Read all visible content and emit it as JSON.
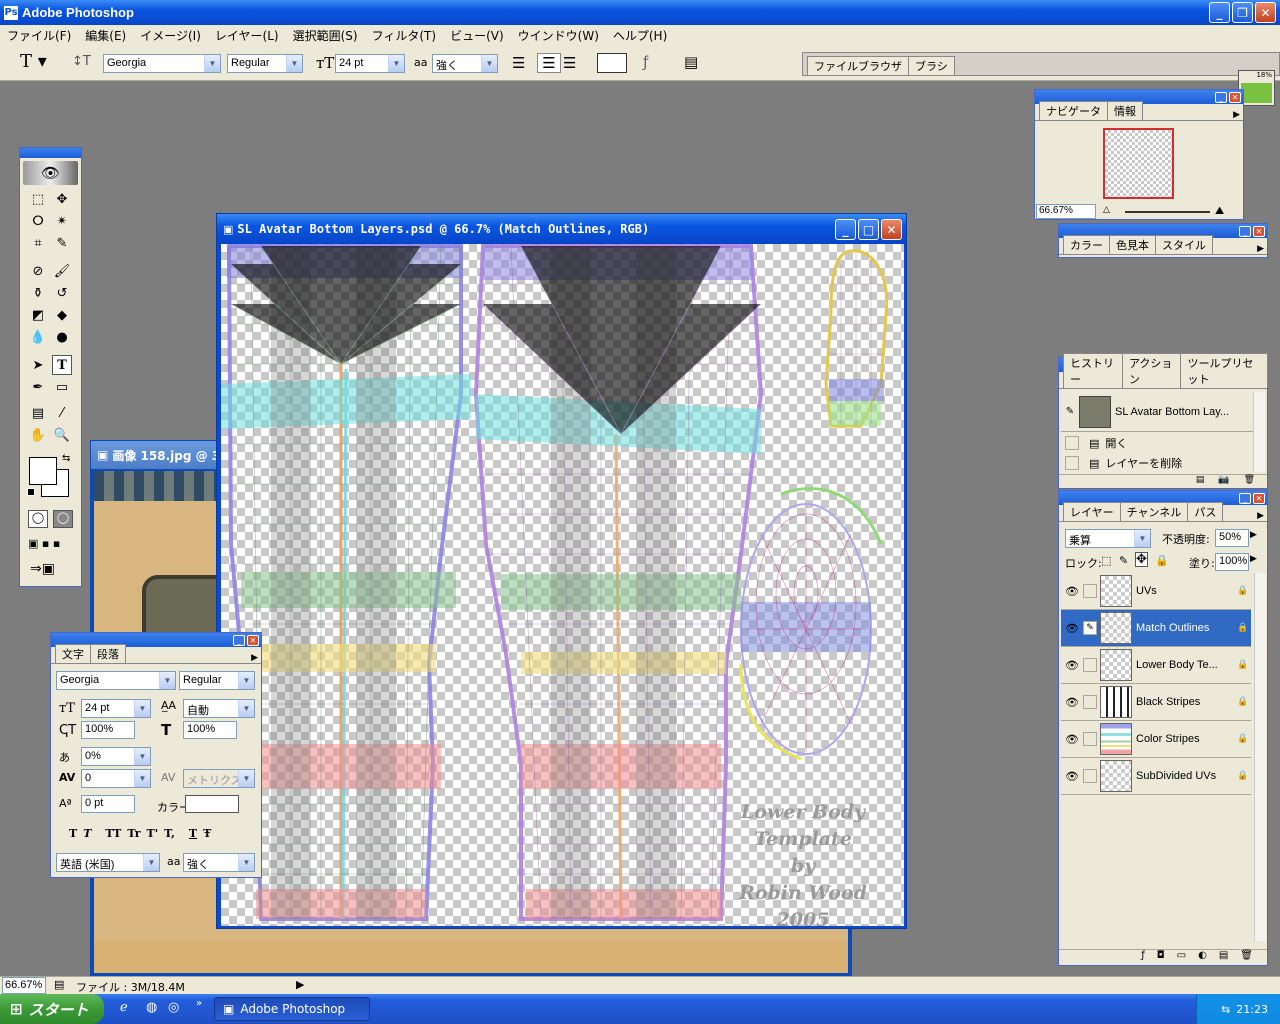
{
  "app": {
    "title": "Adobe Photoshop"
  },
  "menu": [
    "ファイル(F)",
    "編集(E)",
    "イメージ(I)",
    "レイヤー(L)",
    "選択範囲(S)",
    "フィルタ(T)",
    "ビュー(V)",
    "ウインドウ(W)",
    "ヘルプ(H)"
  ],
  "options": {
    "tool_glyph": "T",
    "font_family": "Georgia",
    "font_style": "Regular",
    "font_size": "24 pt",
    "aa_label": "aa",
    "antialias": "強く",
    "palette_well_tabs": [
      "ファイルブラウザ",
      "ブラシ"
    ]
  },
  "document": {
    "title": "SL Avatar Bottom Layers.psd @ 66.7% (Match Outlines, RGB)",
    "watermark": [
      "Lower Body",
      "Template",
      "by",
      "Robin Wood",
      "2005"
    ]
  },
  "bg_document": {
    "title": "画像 158.jpg @ 3"
  },
  "navigator": {
    "tabs": [
      "ナビゲータ",
      "情報"
    ],
    "zoom": "66.67%"
  },
  "color_palette": {
    "tabs": [
      "カラー",
      "色見本",
      "スタイル"
    ]
  },
  "history": {
    "tabs": [
      "ヒストリー",
      "アクション",
      "ツールプリセット"
    ],
    "snapshot": "SL Avatar Bottom Lay...",
    "items": [
      "開く",
      "レイヤーを削除"
    ]
  },
  "layers": {
    "tabs": [
      "レイヤー",
      "チャンネル",
      "パス"
    ],
    "blend_mode": "乗算",
    "opacity_label": "不透明度:",
    "opacity": "50%",
    "lock_label": "ロック:",
    "fill_label": "塗り:",
    "fill": "100%",
    "items": [
      {
        "name": "UVs",
        "selected": false
      },
      {
        "name": "Match Outlines",
        "selected": true
      },
      {
        "name": "Lower Body Te...",
        "selected": false
      },
      {
        "name": "Black Stripes",
        "selected": false
      },
      {
        "name": "Color Stripes",
        "selected": false
      },
      {
        "name": "SubDivided UVs",
        "selected": false
      }
    ]
  },
  "character": {
    "tabs": [
      "文字",
      "段落"
    ],
    "font_family": "Georgia",
    "font_style": "Regular",
    "size": "24 pt",
    "leading": "自動",
    "vscale": "100%",
    "hscale": "100%",
    "tracking_pct": "0%",
    "kerning": "0",
    "metrics": "メトリクス",
    "baseline": "0 pt",
    "color_label": "カラー:",
    "style_buttons": [
      "T",
      "T",
      "TT",
      "Tr",
      "T'",
      "T,",
      "T",
      "Ŧ"
    ],
    "language": "英語 (米国)",
    "aa_label": "aa",
    "antialias": "強く"
  },
  "status": {
    "zoom": "66.67%",
    "file_info": "ファイル : 3M/18.4M"
  },
  "taskbar": {
    "start": "スタート",
    "task": "Adobe Photoshop",
    "time": "21:23"
  },
  "widget": {
    "percent": "18%"
  }
}
